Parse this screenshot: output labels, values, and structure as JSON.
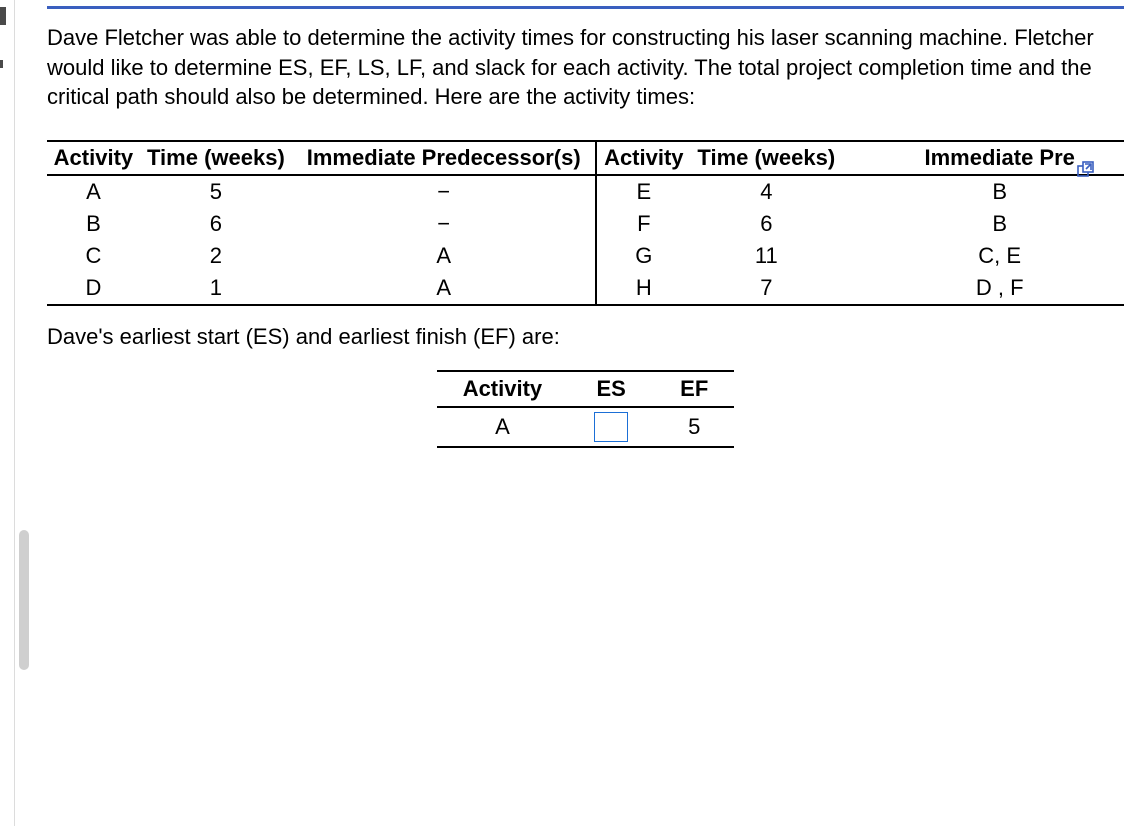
{
  "problem_text": "Dave Fletcher was able to determine the activity times for constructing his laser scanning machine. Fletcher would like to determine ES, EF, LS, LF, and slack for each activity. The total project completion time and the critical path should also be determined. Here are the activity times:",
  "data_table": {
    "headers": {
      "activity_left": "Activity",
      "time_left": "Time (weeks)",
      "pred_left": "Immediate Predecessor(s)",
      "activity_right": "Activity",
      "time_right": "Time (weeks)",
      "pred_right": "Immediate Pre"
    },
    "rows": [
      {
        "a1": "A",
        "t1": "5",
        "p1": "−",
        "a2": "E",
        "t2": "4",
        "p2": "B"
      },
      {
        "a1": "B",
        "t1": "6",
        "p1": "−",
        "a2": "F",
        "t2": "6",
        "p2": "B"
      },
      {
        "a1": "C",
        "t1": "2",
        "p1": "A",
        "a2": "G",
        "t2": "11",
        "p2": "C, E"
      },
      {
        "a1": "D",
        "t1": "1",
        "p1": "A",
        "a2": "H",
        "t2": "7",
        "p2": "D , F"
      }
    ]
  },
  "sub_text": "Dave's earliest start (ES) and earliest finish (EF) are:",
  "answer_table": {
    "headers": {
      "activity": "Activity",
      "es": "ES",
      "ef": "EF"
    },
    "rows": [
      {
        "activity": "A",
        "es": "",
        "ef": "5"
      }
    ]
  },
  "icons": {
    "popout": "popout-icon"
  }
}
